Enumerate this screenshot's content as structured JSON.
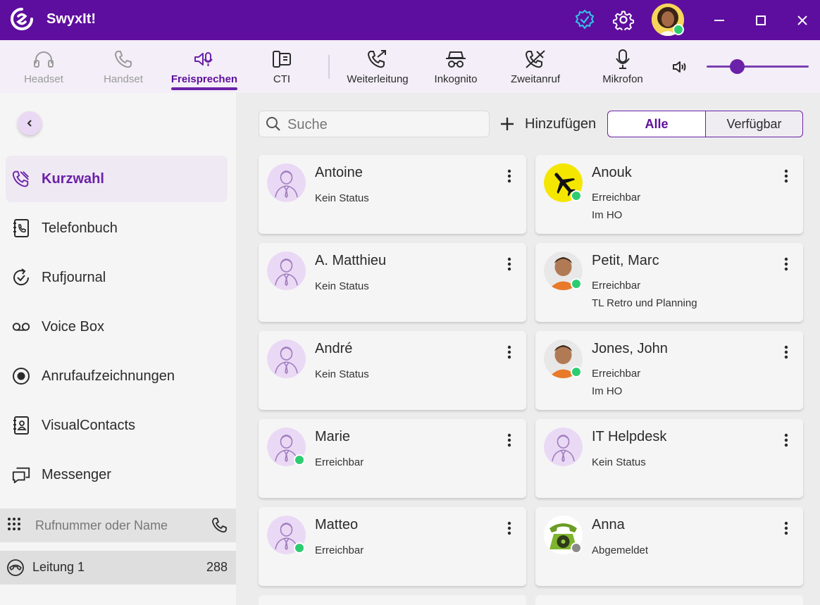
{
  "app": {
    "title": "SwyxIt!"
  },
  "toolbar": {
    "headset": "Headset",
    "handset": "Handset",
    "freisprechen": "Freisprechen",
    "cti": "CTI",
    "weiterleitung": "Weiterleitung",
    "inkognito": "Inkognito",
    "zweitanruf": "Zweitanruf",
    "mikrofon": "Mikrofon",
    "volume_level_percent": 30
  },
  "sidebar": {
    "items": [
      {
        "label": "Kurzwahl",
        "icon": "phone-handset-icon",
        "active": true
      },
      {
        "label": "Telefonbuch",
        "icon": "phonebook-icon"
      },
      {
        "label": "Rufjournal",
        "icon": "call-journal-icon"
      },
      {
        "label": "Voice Box",
        "icon": "voicemail-icon"
      },
      {
        "label": "Anrufaufzeichnungen",
        "icon": "record-icon"
      },
      {
        "label": "VisualContacts",
        "icon": "contacts-icon"
      },
      {
        "label": "Messenger",
        "icon": "messenger-icon"
      }
    ],
    "dial_placeholder": "Rufnummer oder Name",
    "line": {
      "label": "Leitung 1",
      "number": "288"
    }
  },
  "main": {
    "search_placeholder": "Suche",
    "add_label": "Hinzufügen",
    "filter_all": "Alle",
    "filter_available": "Verfügbar"
  },
  "contacts": [
    {
      "name": "Antoine",
      "status": "Kein Status",
      "note": "",
      "avatar": "placeholder-person-icon",
      "presence": "none"
    },
    {
      "name": "Anouk",
      "status": "Erreichbar",
      "note": "Im HO",
      "avatar": "airplane-icon",
      "presence": "online"
    },
    {
      "name": "A. Matthieu",
      "status": "Kein Status",
      "note": "",
      "avatar": "placeholder-person-icon",
      "presence": "none"
    },
    {
      "name": "Petit, Marc",
      "status": "Erreichbar",
      "note": "TL Retro und Planning",
      "avatar": "photo-avatar",
      "presence": "online"
    },
    {
      "name": "André",
      "status": "Kein Status",
      "note": "",
      "avatar": "placeholder-person-icon",
      "presence": "none"
    },
    {
      "name": "Jones, John",
      "status": "Erreichbar",
      "note": "Im HO",
      "avatar": "photo-avatar",
      "presence": "online"
    },
    {
      "name": "Marie",
      "status": "Erreichbar",
      "note": "",
      "avatar": "placeholder-person-icon",
      "presence": "online"
    },
    {
      "name": "IT Helpdesk",
      "status": "Kein Status",
      "note": "",
      "avatar": "placeholder-person-icon",
      "presence": "none"
    },
    {
      "name": "Matteo",
      "status": "Erreichbar",
      "note": "",
      "avatar": "placeholder-person-icon",
      "presence": "online"
    },
    {
      "name": "Anna",
      "status": "Abgemeldet",
      "note": "",
      "avatar": "rotary-phone-icon",
      "presence": "offline"
    }
  ],
  "colors": {
    "brand": "#5e0e9e",
    "online": "#2ecc71",
    "offline": "#8a8a8a",
    "avatar_bg": "#ead9f4"
  }
}
